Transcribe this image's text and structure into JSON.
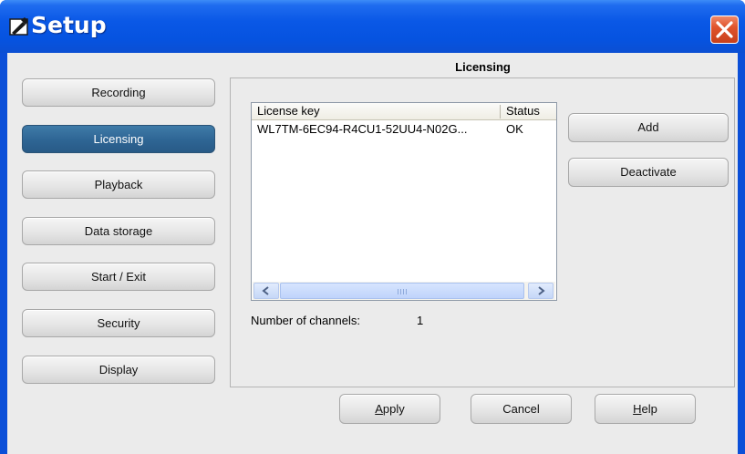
{
  "window": {
    "title": "Setup"
  },
  "sidebar": {
    "items": [
      {
        "label": "Recording",
        "active": false
      },
      {
        "label": "Licensing",
        "active": true
      },
      {
        "label": "Playback",
        "active": false
      },
      {
        "label": "Data storage",
        "active": false
      },
      {
        "label": "Start / Exit",
        "active": false
      },
      {
        "label": "Security",
        "active": false
      },
      {
        "label": "Display",
        "active": false
      }
    ]
  },
  "main": {
    "section_title": "Licensing",
    "license_list": {
      "columns": [
        "License key",
        "Status"
      ],
      "rows": [
        {
          "key": "WL7TM-6EC94-R4CU1-52UU4-N02G...",
          "status": "OK"
        }
      ]
    },
    "actions": {
      "add_label": "Add",
      "deactivate_label": "Deactivate"
    },
    "channels": {
      "label": "Number of channels:",
      "value": "1"
    }
  },
  "footer": {
    "apply": {
      "mnemonic": "A",
      "rest": "pply"
    },
    "cancel": "Cancel",
    "help": {
      "mnemonic": "H",
      "rest": "elp"
    }
  },
  "colors": {
    "titlebar": "#0653e0",
    "active_nav": "#2e6594",
    "close_button": "#e0542d",
    "client_bg": "#ebebeb"
  },
  "icons": [
    "setup-app-icon",
    "close-icon",
    "scroll-left-icon",
    "scroll-right-icon"
  ]
}
